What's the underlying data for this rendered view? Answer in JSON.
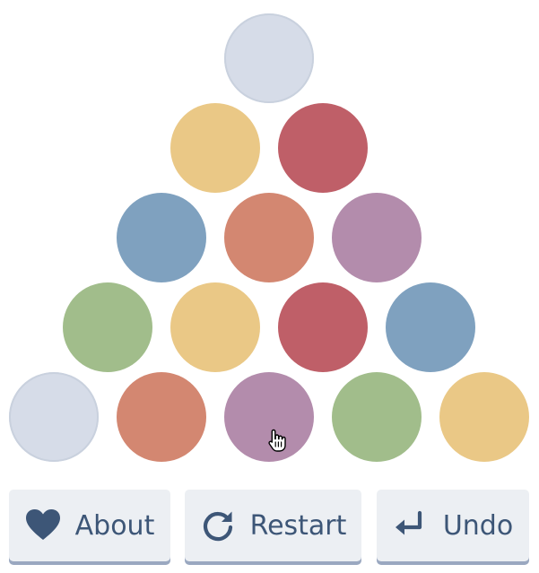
{
  "colors": {
    "empty": "#d6dce8",
    "yellow": "#eac886",
    "red": "#bf5f68",
    "blue": "#7fa1bf",
    "orange": "#d38771",
    "purple": "#b38cac",
    "green": "#a1bd8b",
    "button_bg": "#eceff3",
    "button_text": "#3d5677"
  },
  "board": {
    "rows": [
      [
        "empty"
      ],
      [
        "yellow",
        "red"
      ],
      [
        "blue",
        "orange",
        "purple"
      ],
      [
        "green",
        "yellow",
        "red",
        "blue"
      ],
      [
        "empty",
        "orange",
        "purple",
        "green",
        "yellow"
      ]
    ]
  },
  "toolbar": {
    "about_label": "About",
    "restart_label": "Restart",
    "undo_label": "Undo",
    "about_icon": "heart-icon",
    "restart_icon": "restart-icon",
    "undo_icon": "undo-icon"
  }
}
